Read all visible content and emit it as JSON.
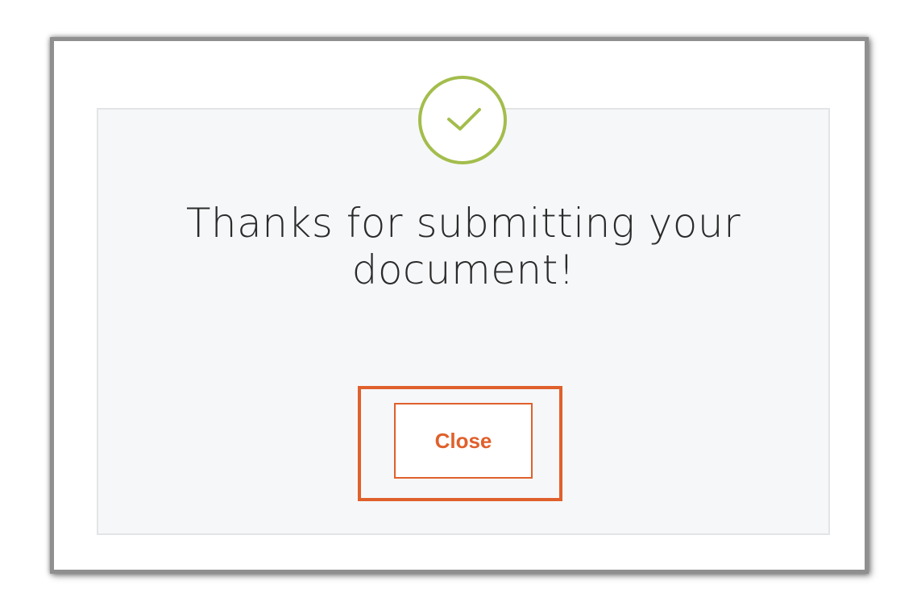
{
  "dialog": {
    "message": "Thanks for submitting your document!",
    "close_label": "Close",
    "icon": "checkmark-icon"
  },
  "colors": {
    "accent": "#e0602c",
    "success": "#a3bd4c",
    "panel_background": "#f6f7f9",
    "text": "#2b2b2b"
  }
}
